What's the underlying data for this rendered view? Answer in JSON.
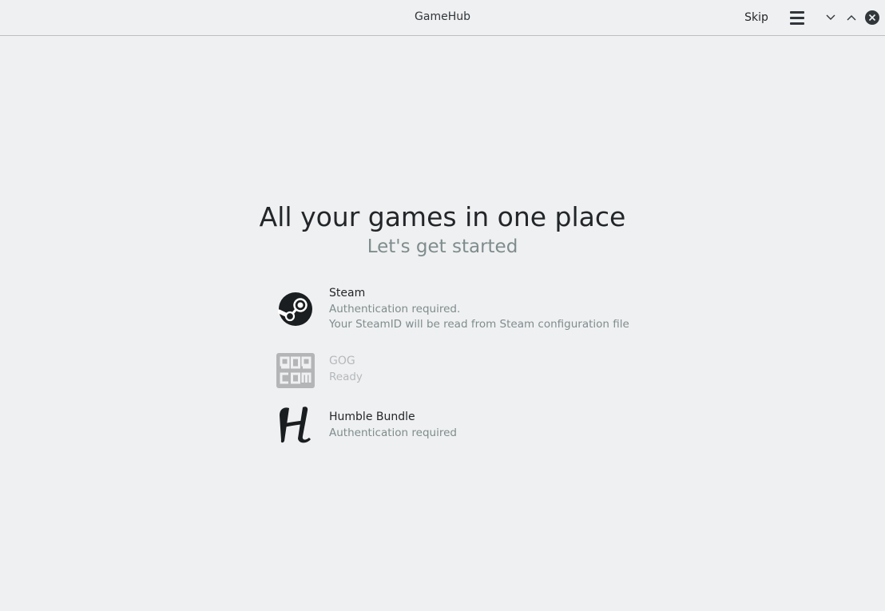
{
  "window": {
    "title": "GameHub",
    "skip_label": "Skip"
  },
  "main": {
    "title": "All your games in one place",
    "subtitle": "Let's get started"
  },
  "sources": [
    {
      "name": "Steam",
      "status": "Authentication required.",
      "detail": "Your SteamID will be read from Steam configuration file",
      "icon": "steam-icon",
      "enabled": true
    },
    {
      "name": "GOG",
      "status": "Ready",
      "icon": "gog-icon",
      "enabled": false
    },
    {
      "name": "Humble Bundle",
      "status": "Authentication required",
      "icon": "humble-bundle-icon",
      "enabled": true
    }
  ],
  "colors": {
    "background": "#eff0f1",
    "text": "#232629",
    "secondary_text": "#7f8c8d",
    "disabled_text": "#b5b9bc"
  }
}
